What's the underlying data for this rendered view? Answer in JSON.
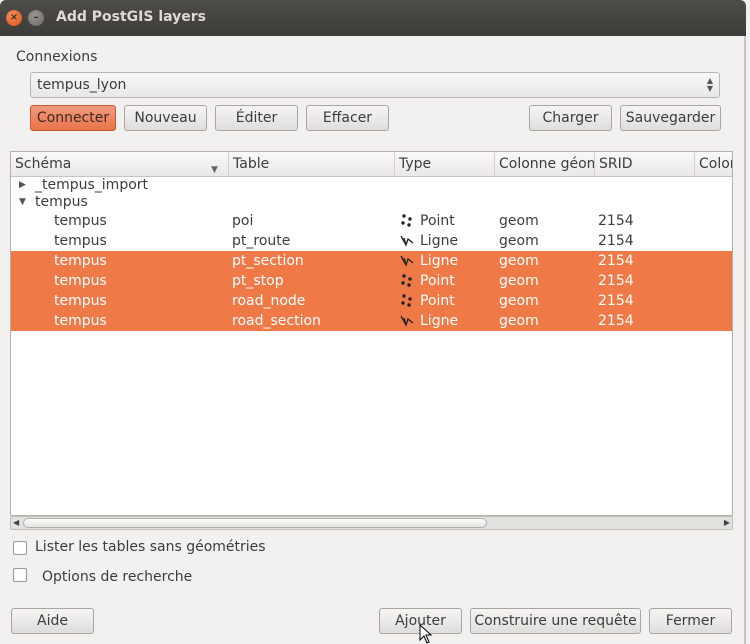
{
  "window": {
    "title": "Add PostGIS layers",
    "close_glyph": "×",
    "minimize_glyph": "–"
  },
  "connections": {
    "label": "Connexions",
    "selected": "tempus_lyon",
    "buttons": {
      "connect": "Connecter",
      "new": "Nouveau",
      "edit": "Éditer",
      "delete": "Effacer",
      "load": "Charger",
      "save": "Sauvegarder"
    }
  },
  "table": {
    "headers": [
      "Schéma",
      "Table",
      "Type",
      "Colonne géom",
      "SRID",
      "Colon"
    ],
    "groups": [
      {
        "name": "_tempus_import",
        "expanded": false
      },
      {
        "name": "tempus",
        "expanded": true
      }
    ],
    "rows": [
      {
        "schema": "tempus",
        "table": "poi",
        "type": "Point",
        "icon": "point-icon",
        "geom": "geom",
        "srid": "2154",
        "selected": false
      },
      {
        "schema": "tempus",
        "table": "pt_route",
        "type": "Ligne",
        "icon": "line-icon",
        "geom": "geom",
        "srid": "2154",
        "selected": false
      },
      {
        "schema": "tempus",
        "table": "pt_section",
        "type": "Ligne",
        "icon": "line-icon",
        "geom": "geom",
        "srid": "2154",
        "selected": true
      },
      {
        "schema": "tempus",
        "table": "pt_stop",
        "type": "Point",
        "icon": "point-icon",
        "geom": "geom",
        "srid": "2154",
        "selected": true
      },
      {
        "schema": "tempus",
        "table": "road_node",
        "type": "Point",
        "icon": "point-icon",
        "geom": "geom",
        "srid": "2154",
        "selected": true
      },
      {
        "schema": "tempus",
        "table": "road_section",
        "type": "Ligne",
        "icon": "line-icon",
        "geom": "geom",
        "srid": "2154",
        "selected": true
      }
    ]
  },
  "options": {
    "list_tables_without_geometry": {
      "label": "Lister les tables sans géométries",
      "checked": false
    },
    "search_options": {
      "label": "Options de recherche",
      "checked": false
    }
  },
  "footer": {
    "help": "Aide",
    "add": "Ajouter",
    "build_query": "Construire une requête",
    "close": "Fermer"
  },
  "colors": {
    "accent": "#ef7a48",
    "primary_button": "#e9734b",
    "titlebar": "#3d3c38"
  }
}
